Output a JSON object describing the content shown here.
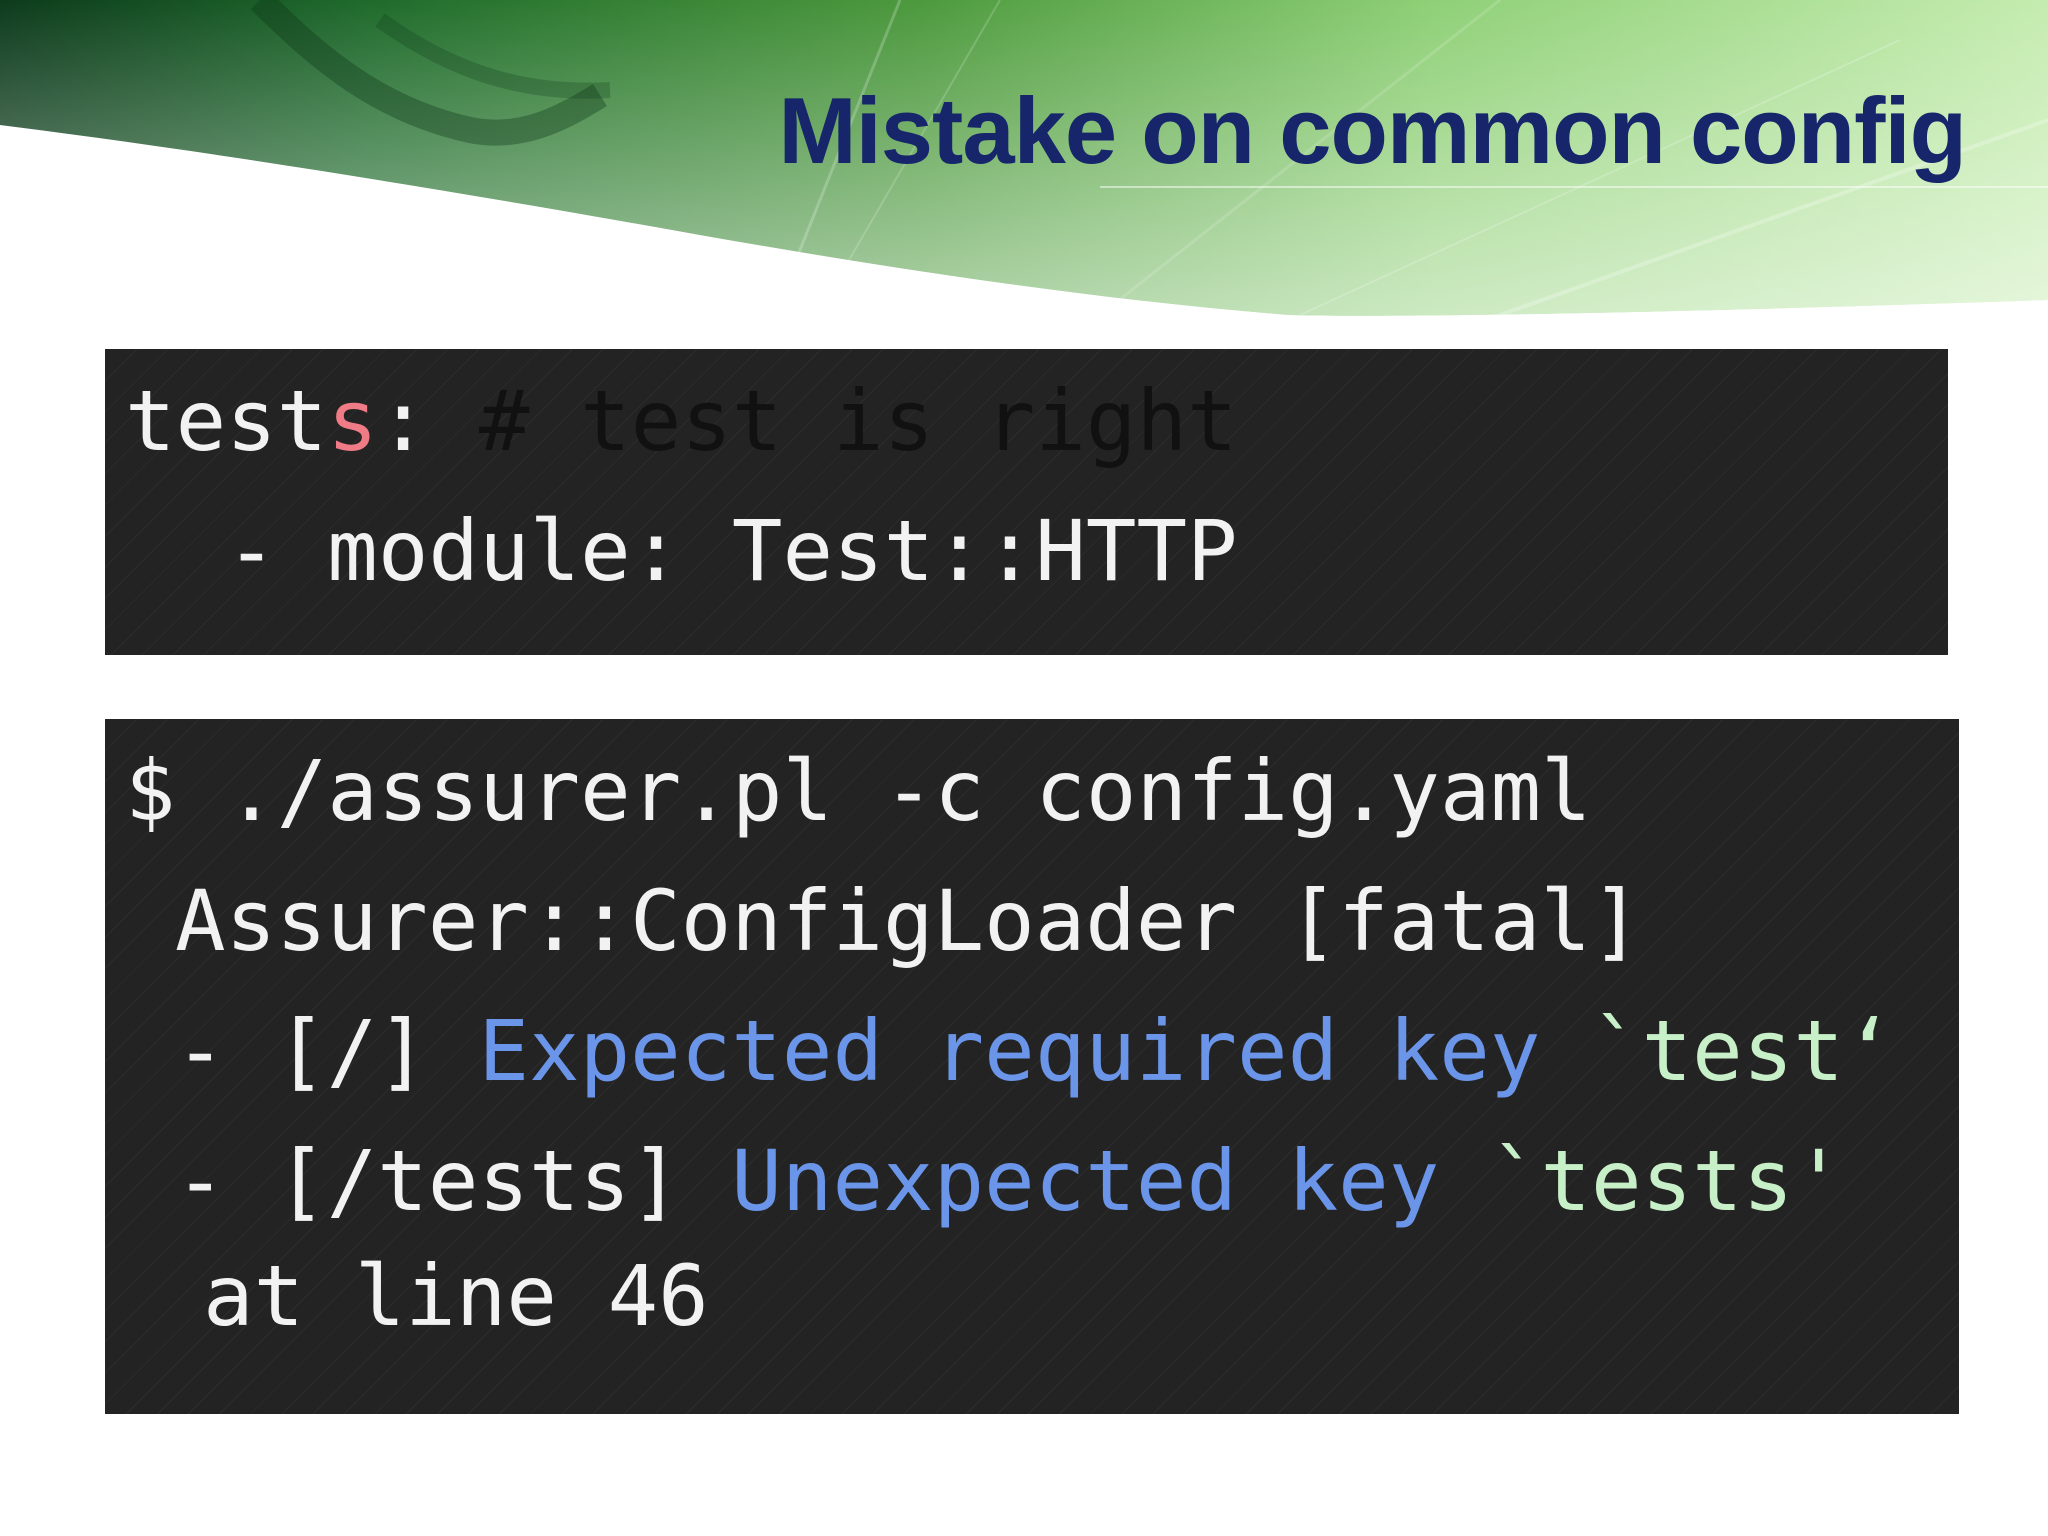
{
  "slide": {
    "title": "Mistake on common config"
  },
  "config_snippet": {
    "line1": {
      "key_prefix": "test",
      "key_mistake": "s",
      "colon": ": ",
      "comment": "# test is right"
    },
    "line2": "  - module: Test::HTTP"
  },
  "terminal_output": {
    "command": "$ ./assurer.pl -c config.yaml",
    "error_header": "Assurer::ConfigLoader [fatal]",
    "error_1": {
      "path": "- [/] ",
      "message": "Expected required key ",
      "key": "`test‘"
    },
    "error_2": {
      "path": "- [/tests] ",
      "message": "Unexpected key ",
      "key": "`tests'"
    },
    "trailer": "at line 46"
  },
  "colors": {
    "title": "#17256b",
    "code_background": "#232323",
    "code_text": "#f2f2f2",
    "highlight_mistake": "#ef7b86",
    "error_message": "#6b95e8",
    "error_key": "#c8f0c8",
    "banner_green_dark": "#1f6b2c",
    "banner_green_light": "#b8e89a"
  },
  "icons": [
    "decorative-leaf-banner"
  ]
}
